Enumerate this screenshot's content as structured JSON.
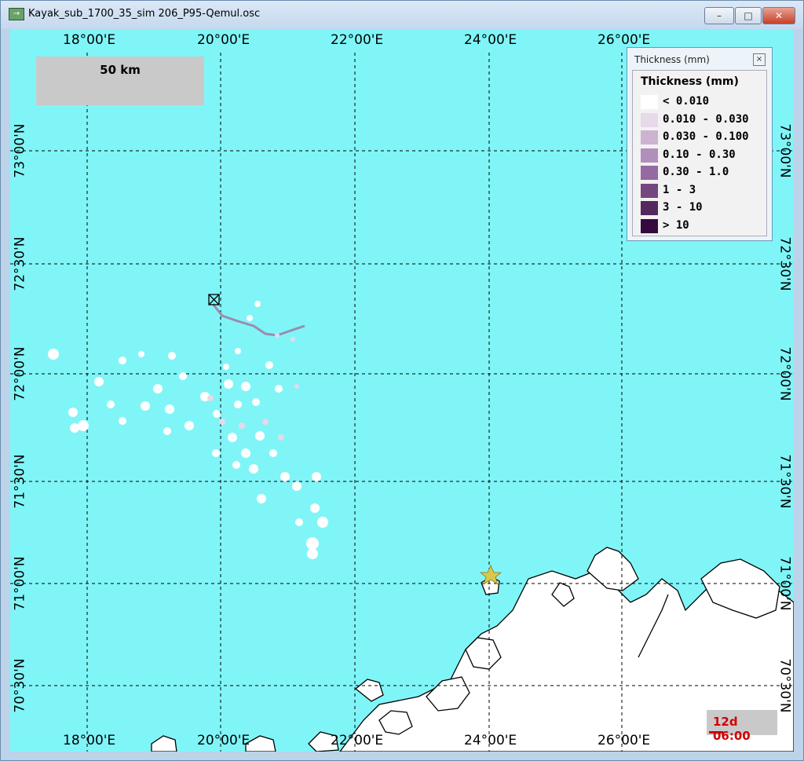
{
  "window": {
    "title": "Kayak_sub_1700_35_sim 206_P95-Qemul.osc",
    "buttons": {
      "minimize": "–",
      "maximize": "□",
      "close": "✕"
    }
  },
  "map": {
    "background_color": "#80f5f7",
    "land_color": "#ffffff",
    "lon_labels": [
      "18°00'E",
      "20°00'E",
      "22°00'E",
      "24°00'E",
      "26°00'E"
    ],
    "lat_labels": [
      "73°00'N",
      "72°30'N",
      "72°00'N",
      "71°30'N",
      "71°00'N",
      "70°30'N"
    ],
    "scale_bar": {
      "label": "50 km"
    },
    "release_site_icon": "boxed-x-icon",
    "time": "12d 06:00"
  },
  "legend": {
    "window_title": "Thickness (mm)",
    "heading": "Thickness (mm)",
    "close_icon": "close-icon",
    "items": [
      {
        "label": "< 0.010",
        "color": "#ffffff"
      },
      {
        "label": "0.010 - 0.030",
        "color": "#e6d9e8"
      },
      {
        "label": "0.030 - 0.100",
        "color": "#cdb3d2"
      },
      {
        "label": "0.10  - 0.30",
        "color": "#b28ebb"
      },
      {
        "label": "0.30  - 1.0",
        "color": "#946aa0"
      },
      {
        "label": "1  -  3",
        "color": "#744780"
      },
      {
        "label": "3 - 10",
        "color": "#54285f"
      },
      {
        "label": "> 10",
        "color": "#350b3f"
      }
    ]
  }
}
